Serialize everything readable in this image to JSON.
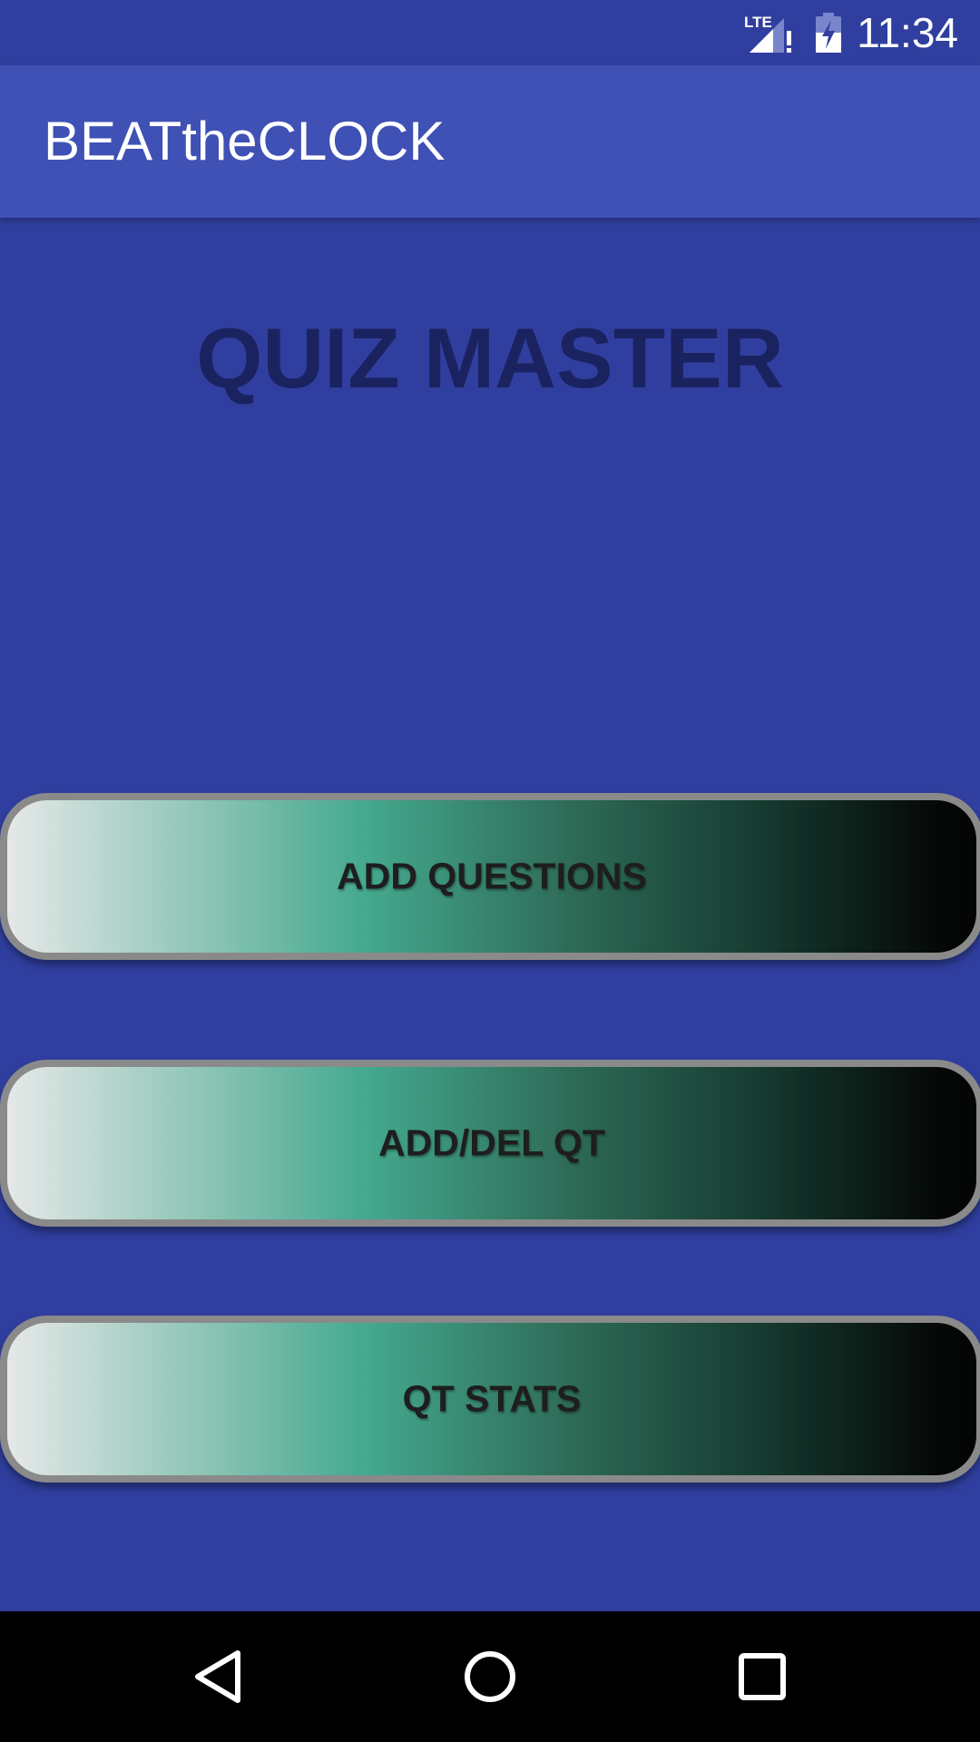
{
  "status_bar": {
    "time": "11:34",
    "network": "LTE"
  },
  "app_bar": {
    "title": "BEATtheCLOCK"
  },
  "main": {
    "heading": "QUIZ MASTER",
    "buttons": [
      {
        "label": "ADD QUESTIONS"
      },
      {
        "label": "ADD/DEL QT"
      },
      {
        "label": "QT STATS"
      }
    ]
  },
  "nav_bar": {
    "icons": [
      "back-icon",
      "home-icon",
      "recents-icon"
    ]
  },
  "colors": {
    "background": "#303f9f",
    "app_bar": "#3f51b5",
    "heading": "#1a2360",
    "button_border": "#8a8a8a",
    "button_gradient_mid": "#44a98e"
  }
}
